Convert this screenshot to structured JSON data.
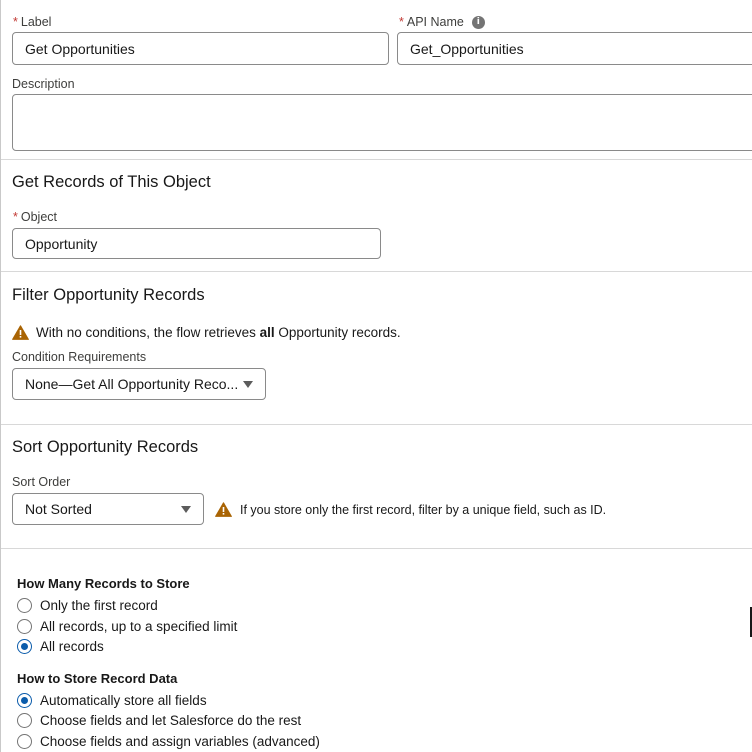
{
  "label_field": {
    "label": "Label",
    "value": "Get Opportunities"
  },
  "api_name_field": {
    "label": "API Name",
    "value": "Get_Opportunities",
    "info_icon": "info-icon"
  },
  "description_field": {
    "label": "Description",
    "value": ""
  },
  "object_section": {
    "title": "Get Records of This Object",
    "object_label": "Object",
    "object_value": "Opportunity"
  },
  "filter_section": {
    "title": "Filter Opportunity Records",
    "warning_prefix": "With no conditions, the flow retrieves ",
    "warning_bold": "all",
    "warning_suffix": " Opportunity records.",
    "condition_label": "Condition Requirements",
    "condition_value": "None—Get All Opportunity Reco..."
  },
  "sort_section": {
    "title": "Sort Opportunity Records",
    "sort_label": "Sort Order",
    "sort_value": "Not Sorted",
    "warning": "If you store only the first record, filter by a unique field, such as ID."
  },
  "store_section": {
    "count_title": "How Many Records to Store",
    "count_options": [
      "Only the first record",
      "All records, up to a specified limit",
      "All records"
    ],
    "count_selected": 2,
    "data_title": "How to Store Record Data",
    "data_options": [
      "Automatically store all fields",
      "Choose fields and let Salesforce do the rest",
      "Choose fields and assign variables (advanced)"
    ],
    "data_selected": 0
  },
  "colors": {
    "required": "#c23934",
    "warning": "#a96404",
    "radio_selected": "#0b5cab"
  }
}
